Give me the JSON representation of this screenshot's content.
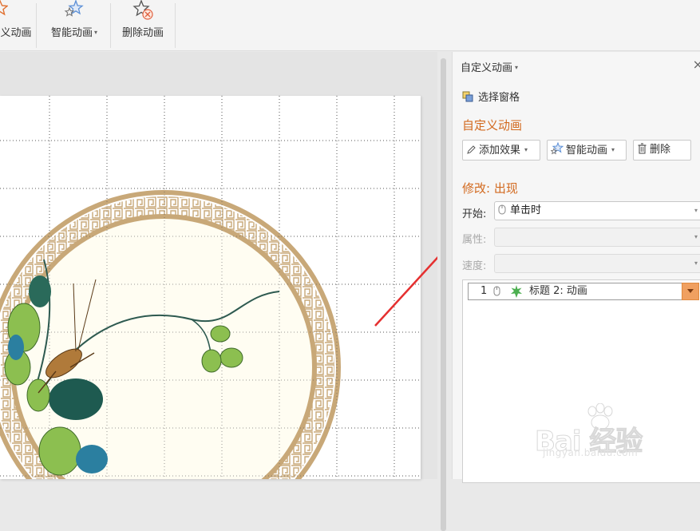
{
  "ribbon": {
    "custom_anim_label": "义动画",
    "smart_anim_label": "智能动画",
    "delete_anim_label": "删除动画"
  },
  "panel": {
    "title": "自定义动画",
    "select_pane_label": "选择窗格",
    "section_title": "自定义动画",
    "add_effect_label": "添加效果",
    "smart_anim_label": "智能动画",
    "delete_label": "删除",
    "modify_title": "修改: 出现",
    "start_label": "开始:",
    "start_value": "单击时",
    "property_label": "属性:",
    "speed_label": "速度:",
    "list_items": [
      {
        "num": "1",
        "text": "标题 2: 动画"
      }
    ]
  },
  "watermark": {
    "main": "Bai  经验",
    "sub": "jingyan.baidu.com"
  },
  "colors": {
    "accent_orange": "#d2691e",
    "arrow_red": "#e53030",
    "ring_tan": "#c8a878",
    "star_blue": "#5b8fd6"
  }
}
